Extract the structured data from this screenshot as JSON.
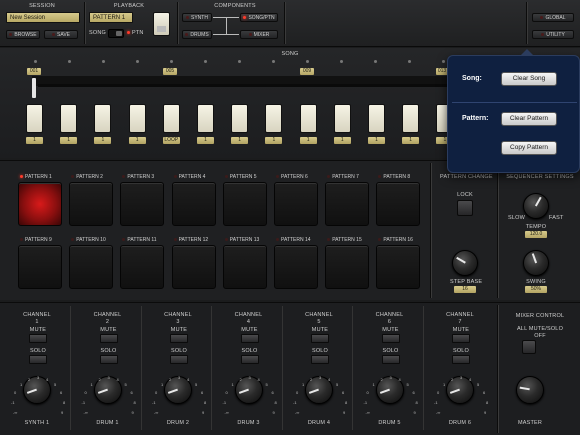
{
  "topbar": {
    "session_label": "SESSION",
    "session_name": "New Session",
    "browse_label": "BROWSE",
    "save_label": "SAVE",
    "playback_label": "PLAYBACK",
    "pattern_display": "PATTERN 1",
    "song_label": "SONG",
    "ptn_label": "PTN",
    "components_label": "COMPONENTS",
    "synth_label": "SYNTH",
    "drums_label": "DRUMS",
    "songptn_label": "SONG/PTN",
    "mixer_label": "MIXER",
    "global_label": "GLOBAL",
    "utility_label": "UTILITY"
  },
  "song": {
    "title": "SONG",
    "markers": [
      "001",
      "005",
      "009",
      "013"
    ],
    "step_labels": [
      "1",
      "1",
      "1",
      "1",
      "LOOP",
      "1",
      "1",
      "1",
      "1",
      "1",
      "1",
      "1",
      "1"
    ]
  },
  "patterns": {
    "items": [
      "PATTERN 1",
      "PATTERN 2",
      "PATTERN 3",
      "PATTERN 4",
      "PATTERN 5",
      "PATTERN 6",
      "PATTERN 7",
      "PATTERN 8",
      "PATTERN 9",
      "PATTERN 10",
      "PATTERN 11",
      "PATTERN 12",
      "PATTERN 13",
      "PATTERN 14",
      "PATTERN 15",
      "PATTERN 16"
    ],
    "active_index": 0
  },
  "pattern_change": {
    "title": "PATTERN CHANGE",
    "lock_label": "LOCK",
    "step_label": "STEP BASE",
    "step_value": "16"
  },
  "sequencer": {
    "title": "SEQUENCER SETTINGS",
    "slow_label": "SLOW",
    "fast_label": "FAST",
    "tempo_label": "TEMPO",
    "tempo_value": "120.0",
    "swing_label": "SWING",
    "swing_value": "50%"
  },
  "mixer": {
    "channels": [
      {
        "title": "CHANNEL",
        "num": "1",
        "name": "SYNTH 1"
      },
      {
        "title": "CHANNEL",
        "num": "2",
        "name": "DRUM 1"
      },
      {
        "title": "CHANNEL",
        "num": "3",
        "name": "DRUM 2"
      },
      {
        "title": "CHANNEL",
        "num": "4",
        "name": "DRUM 3"
      },
      {
        "title": "CHANNEL",
        "num": "5",
        "name": "DRUM 4"
      },
      {
        "title": "CHANNEL",
        "num": "6",
        "name": "DRUM 5"
      },
      {
        "title": "CHANNEL",
        "num": "7",
        "name": "DRUM 6"
      }
    ],
    "mute_label": "MUTE",
    "solo_label": "SOLO",
    "control_title": "MIXER CONTROL",
    "all_mute_label": "ALL MUTE/SOLO",
    "off_label": "OFF",
    "master_label": "MASTER",
    "knob_ticks": [
      "-∞",
      "-2",
      "-1",
      "0",
      "1",
      "2",
      "3",
      "4",
      "5",
      "6",
      "7",
      "8",
      "9",
      "10"
    ]
  },
  "popup": {
    "song_label": "Song:",
    "clear_song": "Clear Song",
    "pattern_label": "Pattern:",
    "clear_pattern": "Clear Pattern",
    "copy_pattern": "Copy Pattern"
  },
  "colors": {
    "led_on": "#ff3a2a",
    "lcd": "#d6c98c",
    "popup_bg": "#0f2040"
  }
}
